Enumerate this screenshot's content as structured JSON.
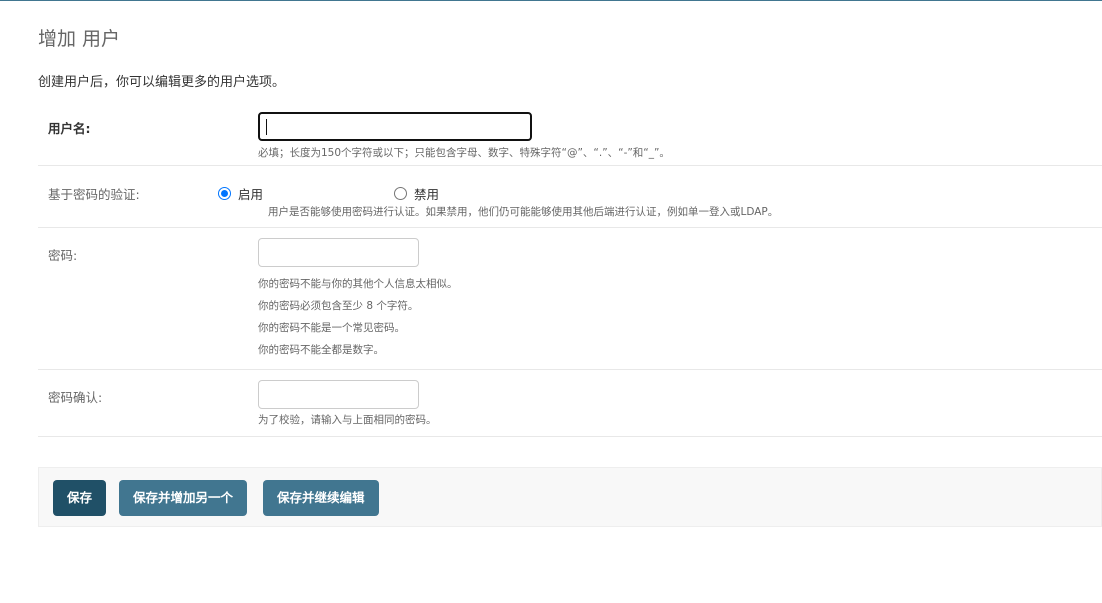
{
  "page": {
    "title": "增加 用户",
    "intro": "创建用户后，你可以编辑更多的用户选项。"
  },
  "fields": {
    "username": {
      "label": "用户名:",
      "value": "",
      "help": "必填；长度为150个字符或以下；只能包含字母、数字、特殊字符“@”、“.”、“-”和“_”。"
    },
    "password_auth": {
      "label": "基于密码的验证:",
      "options": [
        "启用",
        "禁用"
      ],
      "selected": "启用",
      "help": "用户是否能够使用密码进行认证。如果禁用，他们仍可能能够使用其他后端进行认证，例如单一登入或LDAP。"
    },
    "password": {
      "label": "密码:",
      "value": "",
      "help": [
        "你的密码不能与你的其他个人信息太相似。",
        "你的密码必须包含至少 8 个字符。",
        "你的密码不能是一个常见密码。",
        "你的密码不能全都是数字。"
      ]
    },
    "password_confirm": {
      "label": "密码确认:",
      "value": "",
      "help": "为了校验，请输入与上面相同的密码。"
    }
  },
  "actions": {
    "save": "保存",
    "save_add_another": "保存并增加另一个",
    "save_continue": "保存并继续编辑"
  },
  "colors": {
    "header": "#417690",
    "default_button": "#205067",
    "secondary_button": "#417690",
    "radio_accent": "#0075ff"
  }
}
